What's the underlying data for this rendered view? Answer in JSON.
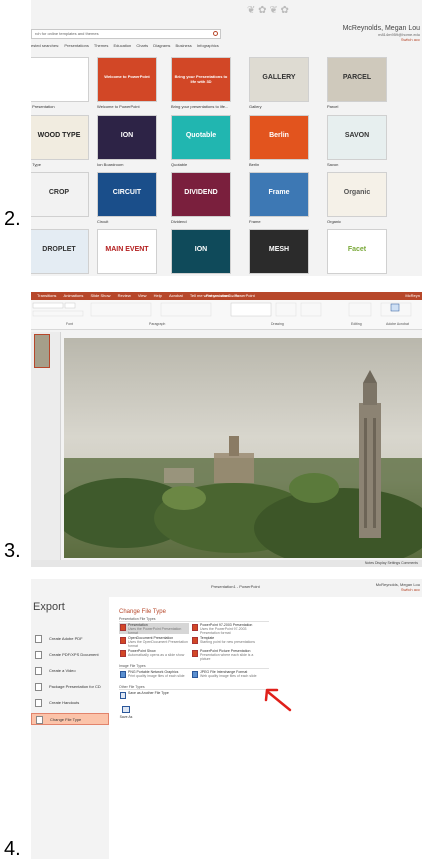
{
  "steps": [
    "2.",
    "3.",
    "4."
  ],
  "shot1": {
    "search_placeholder": "rch for online templates and themes",
    "suggested": [
      "ested searches:",
      "Presentations",
      "Themes",
      "Education",
      "Charts",
      "Diagrams",
      "Business",
      "Infographics"
    ],
    "user_name": "McReynolds, Megan Lou",
    "user_email": "m814m959@home.edu",
    "switch_account": "Switch acc",
    "tiles": [
      {
        "label": "k Presentation",
        "text": "",
        "bg": "#ffffff",
        "fg": "#333333"
      },
      {
        "label": "Welcome to PowerPoint",
        "text": "Welcome to PowerPoint",
        "bg": "#d24726",
        "fg": "#ffffff"
      },
      {
        "label": "Bring your presentations to life...",
        "text": "Bring your Presentations to life with 3D",
        "bg": "#d24726",
        "fg": "#ffffff"
      },
      {
        "label": "Gallery",
        "text": "GALLERY",
        "bg": "#dedbd2",
        "fg": "#333333"
      },
      {
        "label": "Parcel",
        "text": "PARCEL",
        "bg": "#cfc9bc",
        "fg": "#333333"
      },
      {
        "label": "d Type",
        "text": "WOOD TYPE",
        "bg": "#f1ece0",
        "fg": "#222222"
      },
      {
        "label": "Ion Boardroom",
        "text": "ION",
        "bg": "#2d2346",
        "fg": "#ffffff"
      },
      {
        "label": "Quotable",
        "text": "Quotable",
        "bg": "#21b6b0",
        "fg": "#ffffff"
      },
      {
        "label": "Berlin",
        "text": "Berlin",
        "bg": "#e2541e",
        "fg": "#ffffff"
      },
      {
        "label": "Savon",
        "text": "SAVON",
        "bg": "#e7efef",
        "fg": "#333333"
      },
      {
        "label": "",
        "text": "CROP",
        "bg": "#f2f2f2",
        "fg": "#333333"
      },
      {
        "label": "Circuit",
        "text": "CIRCUIT",
        "bg": "#1a4e8a",
        "fg": "#ffffff"
      },
      {
        "label": "Dividend",
        "text": "DIVIDEND",
        "bg": "#7a1f3d",
        "fg": "#ffffff"
      },
      {
        "label": "Frame",
        "text": "Frame",
        "bg": "#3d78b4",
        "fg": "#ffffff"
      },
      {
        "label": "Organic",
        "text": "Organic",
        "bg": "#f5f1e8",
        "fg": "#555555"
      },
      {
        "label": "pler",
        "text": "DROPLET",
        "bg": "#e4ecf3",
        "fg": "#333333"
      },
      {
        "label": "Main Event",
        "text": "MAIN EVENT",
        "bg": "#ffffff",
        "fg": "#b31d1d"
      },
      {
        "label": "Ion",
        "text": "ION",
        "bg": "#0f4a5a",
        "fg": "#ffffff"
      },
      {
        "label": "Mesh",
        "text": "MESH",
        "bg": "#2b2b2b",
        "fg": "#ffffff"
      },
      {
        "label": "Facet",
        "text": "Facet",
        "bg": "#ffffff",
        "fg": "#7aa93a"
      }
    ]
  },
  "shot2": {
    "tabs": [
      "Transitions",
      "Animations",
      "Slide Show",
      "Review",
      "View",
      "Help",
      "Acrobat",
      "Tell me what you want to do"
    ],
    "title": "Presentation1 - PowerPoint",
    "user": "McReyn",
    "groups": [
      "Font",
      "Paragraph",
      "Drawing",
      "Editing",
      "Adobe Acrobat"
    ],
    "status": "Notes   Display Settings   Comments"
  },
  "shot3": {
    "title": "Presentation1 - PowerPoint",
    "user": "McReynolds, Megan Lou",
    "switch_account": "Switch acc",
    "heading": "Export",
    "left_items": [
      "Create Adobe PDF",
      "Create PDF/XPS Document",
      "Create a Video",
      "Package Presentation for CD",
      "Create Handouts",
      "Change File Type"
    ],
    "main_title": "Change File Type",
    "presentation_section": "Presentation File Types",
    "image_section": "Image File Types",
    "other_section": "Other File Types",
    "options": [
      {
        "name": "Presentation",
        "desc": "Uses the PowerPoint Presentation format"
      },
      {
        "name": "PowerPoint 97-2003 Presentation",
        "desc": "Uses the PowerPoint 97-2003 Presentation format"
      },
      {
        "name": "OpenDocument Presentation",
        "desc": "Uses the OpenDocument Presentation format"
      },
      {
        "name": "Template",
        "desc": "Starting point for new presentations"
      },
      {
        "name": "PowerPoint Show",
        "desc": "Automatically opens as a slide show"
      },
      {
        "name": "PowerPoint Picture Presentation",
        "desc": "Presentation where each slide is a picture"
      },
      {
        "name": "PNG Portable Network Graphics",
        "desc": "Print quality image files of each slide"
      },
      {
        "name": "JPEG File Interchange Format",
        "desc": "Web quality image files of each slide"
      },
      {
        "name": "Save as Another File Type",
        "desc": ""
      }
    ],
    "save_as": "Save As"
  }
}
